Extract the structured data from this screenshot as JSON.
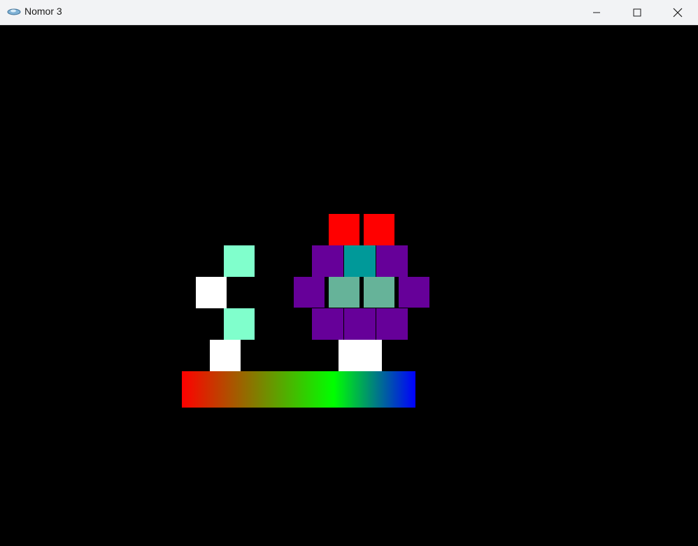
{
  "window": {
    "title": "Nomor 3",
    "icons": {
      "app": "game-app-icon",
      "minimize": "minimize-icon",
      "maximize": "maximize-icon",
      "close": "close-icon"
    }
  },
  "scene": {
    "background": "#000000",
    "colors": {
      "red": "#ff0000",
      "purple": "#660099",
      "teal": "#009999",
      "sage": "#66b399",
      "aquamarine": "#80ffcc",
      "white": "#ffffff"
    },
    "gauge_gradient": [
      "#ff0000",
      "#00ff00",
      "#0000ff"
    ]
  }
}
